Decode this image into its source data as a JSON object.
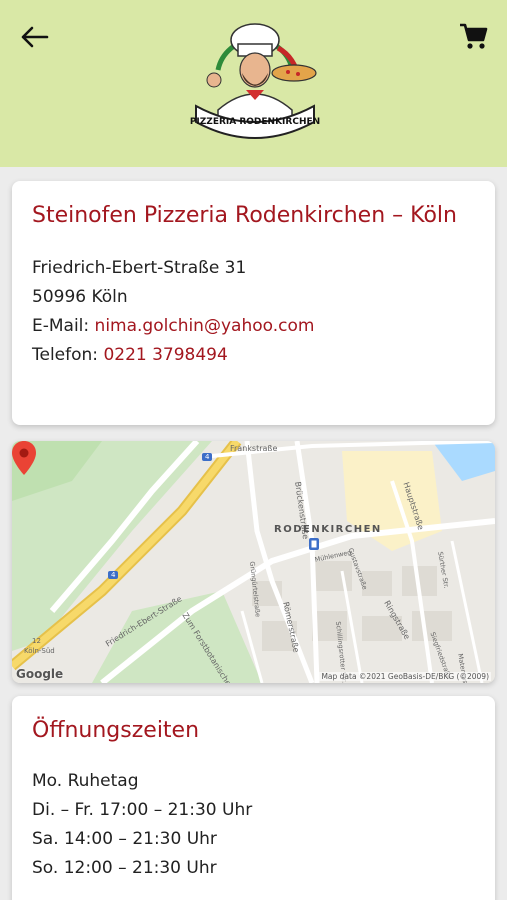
{
  "header": {
    "logo_text": "PIZZERIA RODENKIRCHEN",
    "back_icon": "arrow-left-icon",
    "cart_icon": "shopping-cart-icon",
    "background_color": "#d9e8a6"
  },
  "address_card": {
    "title": "Steinofen Pizzeria Rodenkirchen – Köln",
    "street": "Friedrich-Ebert-Straße 31",
    "city": "50996 Köln",
    "email_label": "E-Mail:",
    "email": "nima.golchin@yahoo.com",
    "phone_label": "Telefon:",
    "phone": "0221 3798494",
    "accent_color": "#a3171f"
  },
  "map": {
    "district": "RODENKIRCHEN",
    "streets": [
      "Frankstraße",
      "Brückenstraße",
      "Hauptstraße",
      "Friedrich-Ebert-Straße",
      "Zum Forstbotanischen Garten",
      "Römerstraße",
      "Ringstraße",
      "Gustavstraße",
      "Schillingsrotter Str.",
      "Sürther Str.",
      "Siegfriedstraße",
      "Maternusstraße",
      "Mühlenweg",
      "Grüngürtelstraße"
    ],
    "highway_shield_1": "4",
    "highway_shield_2": "4",
    "exit_number": "12",
    "exit_name": "Köln-Süd",
    "attribution": "Map data ©2021 GeoBasis-DE/BKG (©2009)",
    "provider": "Google"
  },
  "hours_card": {
    "title": "Öffnungszeiten",
    "lines": [
      "Mo. Ruhetag",
      "Di. – Fr. 17:00 – 21:30 Uhr",
      "Sa. 14:00 – 21:30 Uhr",
      "So. 12:00 – 21:30 Uhr"
    ]
  }
}
